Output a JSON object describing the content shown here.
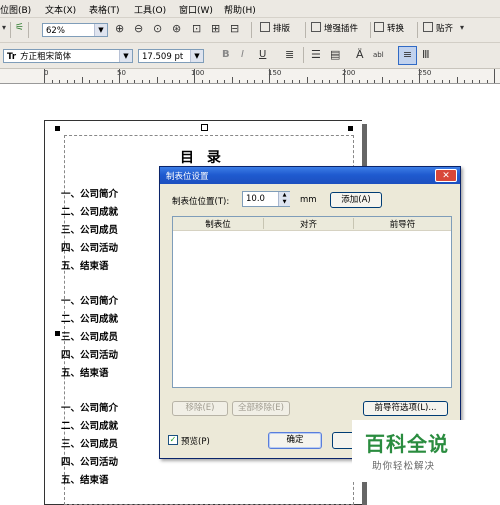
{
  "menu": {
    "items": [
      "位图(B)",
      "文本(X)",
      "表格(T)",
      "工具(O)",
      "窗口(W)",
      "帮助(H)"
    ]
  },
  "toolbar1": {
    "zoom_value": "62%",
    "buttons": [
      "排版",
      "增强插件",
      "转换",
      "贴齐"
    ]
  },
  "toolbar2": {
    "font_name": "方正粗宋简体",
    "font_size": "17.509 pt",
    "font_icon_glyph": "Tr",
    "bold_glyph": "B",
    "italic_glyph": "I",
    "underline_glyph": "U",
    "abl_glyph": "abl"
  },
  "ruler": {
    "labels": [
      "0",
      "50",
      "100",
      "150",
      "200",
      "250"
    ]
  },
  "document": {
    "title": "目 录",
    "groups": [
      [
        "一、公司简介",
        "二、公司成就",
        "三、公司成员",
        "四、公司活动",
        "五、结束语"
      ],
      [
        "一、公司简介",
        "二、公司成就",
        "三、公司成员",
        "四、公司活动",
        "五、结束语"
      ],
      [
        "一、公司简介",
        "二、公司成就",
        "三、公司成员",
        "四、公司活动",
        "五、结束语"
      ]
    ]
  },
  "dialog": {
    "title": "制表位设置",
    "close_glyph": "✕",
    "position_label": "制表位位置(T):",
    "position_value": "10.0",
    "unit": "mm",
    "add_button": "添加(A)",
    "columns": [
      "制表位",
      "对齐",
      "前导符"
    ],
    "remove_button": "移除(E)",
    "remove_all_button": "全部移除(E)",
    "leader_button": "前导符选项(L)...",
    "preview_label": "预览(P)",
    "preview_checked": true,
    "ok_button": "确定"
  },
  "watermark": {
    "logo": "百科全说",
    "sub": "助你轻松解决",
    "color": "#2a8c3f"
  },
  "colors": {
    "titlebar": "#1f5bd0",
    "dialog_bg": "#ece9d8",
    "toolbar_bg": "#ece9e3"
  }
}
